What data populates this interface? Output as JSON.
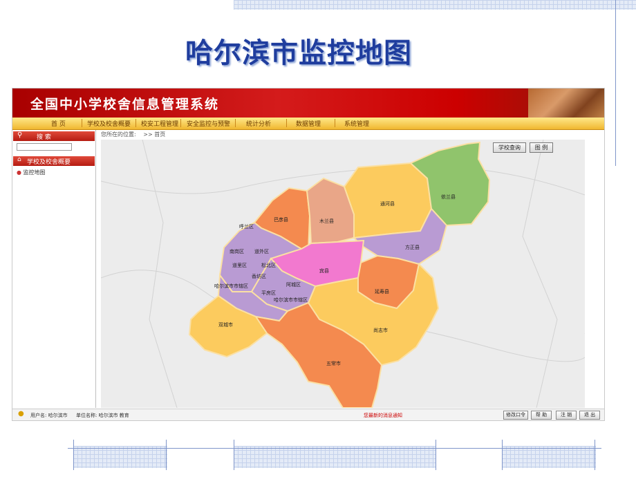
{
  "slide": {
    "title": "哈尔滨市监控地图"
  },
  "app": {
    "title": "全国中小学校舍信息管理系统"
  },
  "nav": [
    "首  页",
    "学校及校舍概要",
    "校安工程管理",
    "安全监控与预警",
    "统计分析",
    "数据管理",
    "系统管理"
  ],
  "sidebar": {
    "search_label": "搜  索",
    "section_label": "学校及校舍概要",
    "link_label": "监控地图"
  },
  "breadcrumb": {
    "prefix": "您所在的位置:",
    "sep": ">>",
    "page": "首页"
  },
  "map": {
    "buttons": {
      "school_query": "学校查询",
      "legend": "图 例"
    },
    "regions": [
      {
        "name": "巴彦县",
        "color": "#f48a4f"
      },
      {
        "name": "木兰县",
        "color": "#e9a688"
      },
      {
        "name": "通河县",
        "color": "#fccb5e"
      },
      {
        "name": "依兰县",
        "color": "#90c46c"
      },
      {
        "name": "呼兰区",
        "color": "#b99bd3"
      },
      {
        "name": "方正县",
        "color": "#b99bd3"
      },
      {
        "name": "宾县",
        "color": "#f279cf"
      },
      {
        "name": "延寿县",
        "color": "#f48a4f"
      },
      {
        "name": "尚志市",
        "color": "#fccb5e"
      },
      {
        "name": "五常市",
        "color": "#f48a4f"
      },
      {
        "name": "双城市",
        "color": "#fccb5e"
      }
    ],
    "district_labels": [
      "南岗区",
      "道外区",
      "道里区",
      "松北区",
      "香坊区",
      "哈尔滨市市辖区",
      "平房区",
      "阿城区",
      "哈尔滨市市辖区"
    ]
  },
  "footer": {
    "user": "用户名: 哈尔滨市",
    "unit": "单位名称: 哈尔滨市 教育",
    "message": "您最新的消息通知",
    "buttons": [
      "修改口令",
      "帮 助",
      "注 销",
      "退 出"
    ]
  }
}
